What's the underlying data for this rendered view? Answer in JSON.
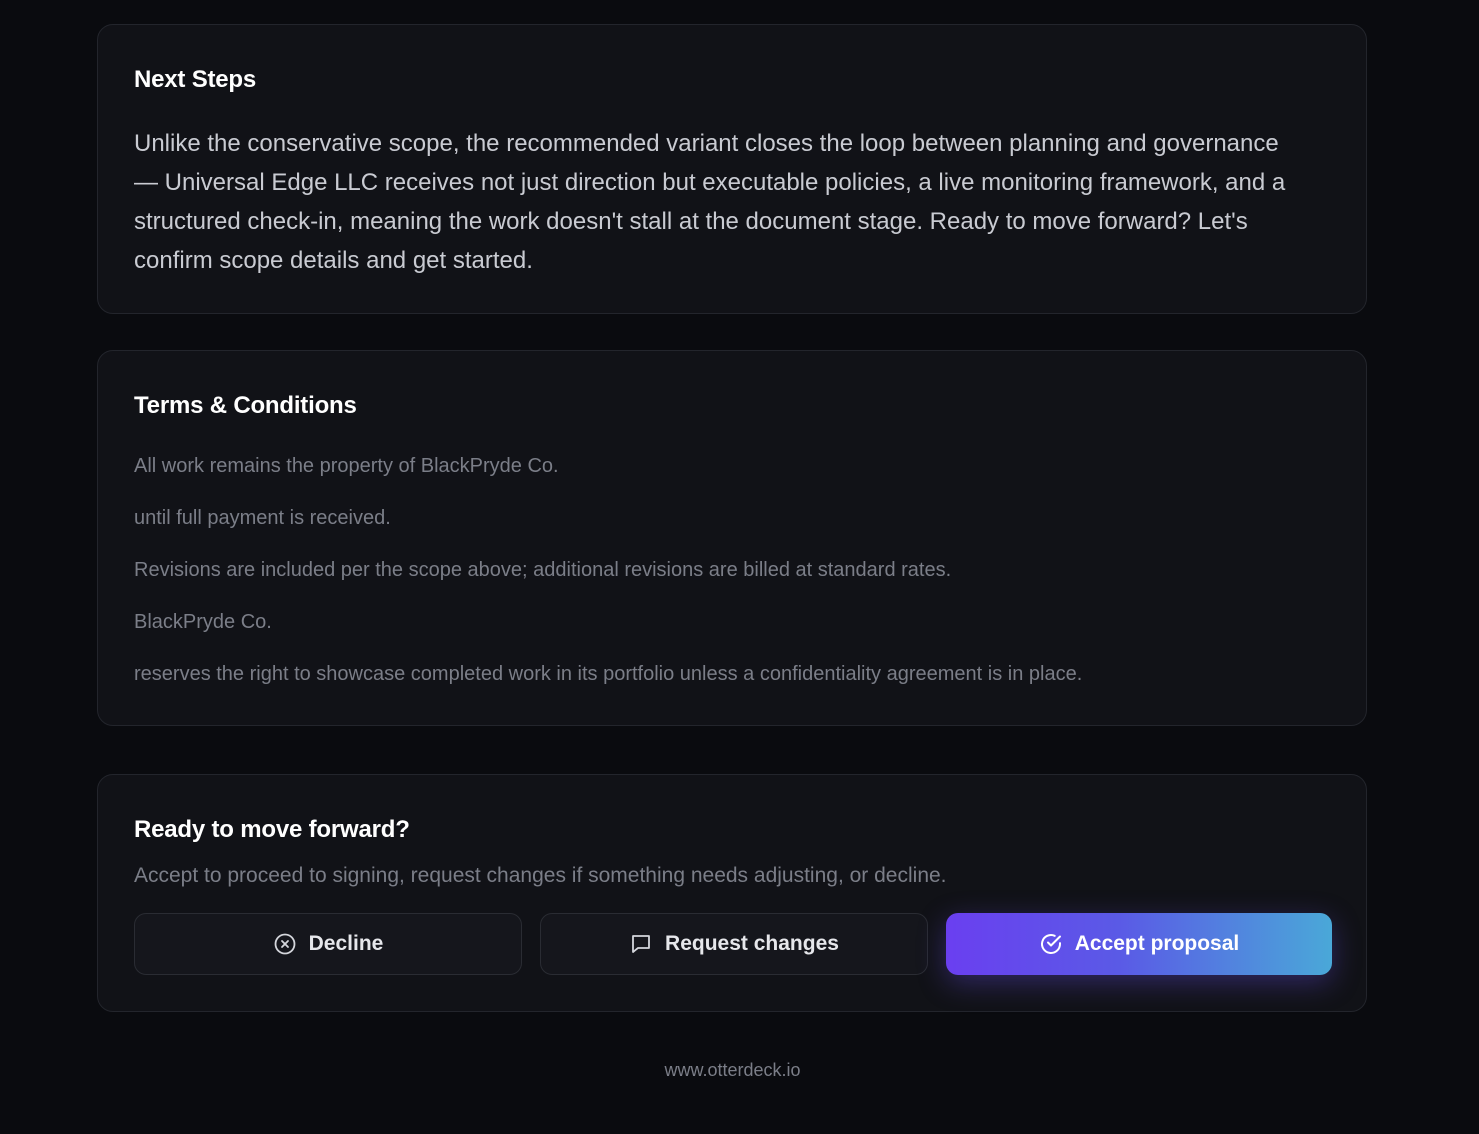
{
  "next_steps": {
    "title": "Next Steps",
    "body": "Unlike the conservative scope, the recommended variant closes the loop between planning and governance — Universal Edge LLC receives not just direction but executable policies, a live monitoring framework, and a structured check-in, meaning the work doesn't stall at the document stage. Ready to move forward? Let's confirm scope details and get started."
  },
  "terms": {
    "title": "Terms & Conditions",
    "items": [
      "All work remains the property of BlackPryde Co.",
      "until full payment is received.",
      "Revisions are included per the scope above; additional revisions are billed at standard rates.",
      "BlackPryde Co.",
      "reserves the right to showcase completed work in its portfolio unless a confidentiality agreement is in place."
    ]
  },
  "cta": {
    "title": "Ready to move forward?",
    "subtitle": "Accept to proceed to signing, request changes if something needs adjusting, or decline.",
    "decline_label": "Decline",
    "decline_icon": "x-circle-icon",
    "request_label": "Request changes",
    "request_icon": "message-square-icon",
    "accept_label": "Accept proposal",
    "accept_icon": "check-circle-icon"
  },
  "footer": {
    "url": "www.otterdeck.io"
  },
  "colors": {
    "background": "#0a0b0f",
    "card": "#111217",
    "accent_start": "#6a3ff0",
    "accent_end": "#4aa8d8"
  }
}
